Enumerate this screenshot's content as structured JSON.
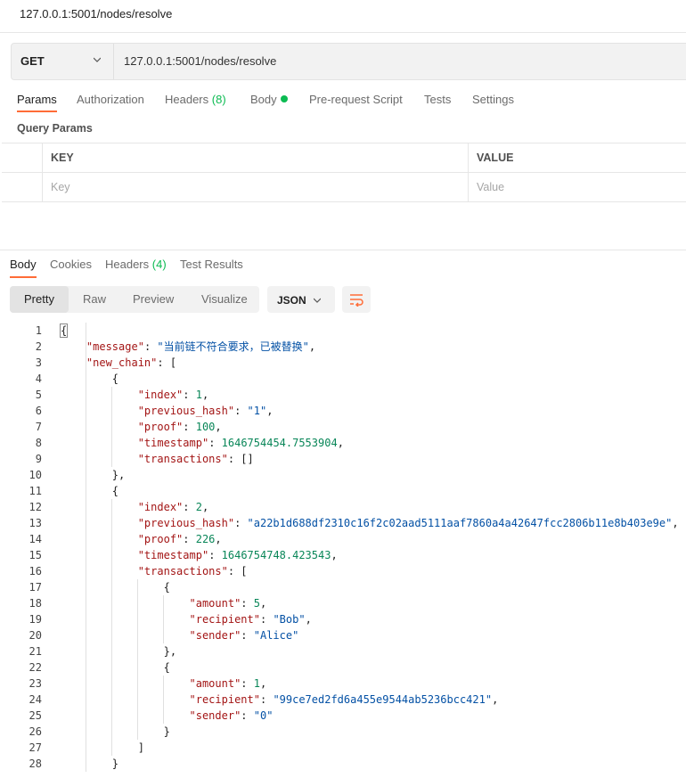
{
  "title": "127.0.0.1:5001/nodes/resolve",
  "request": {
    "method": "GET",
    "url": "127.0.0.1:5001/nodes/resolve"
  },
  "request_tabs": [
    {
      "label": "Params"
    },
    {
      "label": "Authorization"
    },
    {
      "label": "Headers",
      "count": "(8)"
    },
    {
      "label": "Body"
    },
    {
      "label": "Pre-request Script"
    },
    {
      "label": "Tests"
    },
    {
      "label": "Settings"
    }
  ],
  "query_params": {
    "label": "Query Params",
    "key_header": "KEY",
    "value_header": "VALUE",
    "key_placeholder": "Key",
    "value_placeholder": "Value"
  },
  "response_tabs": [
    {
      "label": "Body"
    },
    {
      "label": "Cookies"
    },
    {
      "label": "Headers",
      "count": "(4)"
    },
    {
      "label": "Test Results"
    }
  ],
  "view_modes": [
    "Pretty",
    "Raw",
    "Preview",
    "Visualize"
  ],
  "format": "JSON",
  "colors": {
    "accent": "#ff6c37",
    "key": "#a31515",
    "string": "#0451a5",
    "number": "#098658",
    "green": "#0cbb52"
  },
  "icons": {
    "method_dropdown": "chevron-down-icon",
    "format_dropdown": "chevron-down-icon",
    "wrap": "wrap-lines-icon"
  },
  "code_lines": [
    [
      [
        "p",
        "{"
      ]
    ],
    [
      [
        "p",
        "    "
      ],
      [
        "k",
        "\"message\""
      ],
      [
        "p",
        ": "
      ],
      [
        "s",
        "\"当前链不符合要求，已被替换\""
      ],
      [
        "p",
        ","
      ]
    ],
    [
      [
        "p",
        "    "
      ],
      [
        "k",
        "\"new_chain\""
      ],
      [
        "p",
        ": ["
      ]
    ],
    [
      [
        "p",
        "        {"
      ]
    ],
    [
      [
        "p",
        "            "
      ],
      [
        "k",
        "\"index\""
      ],
      [
        "p",
        ": "
      ],
      [
        "n",
        "1"
      ],
      [
        "p",
        ","
      ]
    ],
    [
      [
        "p",
        "            "
      ],
      [
        "k",
        "\"previous_hash\""
      ],
      [
        "p",
        ": "
      ],
      [
        "s",
        "\"1\""
      ],
      [
        "p",
        ","
      ]
    ],
    [
      [
        "p",
        "            "
      ],
      [
        "k",
        "\"proof\""
      ],
      [
        "p",
        ": "
      ],
      [
        "n",
        "100"
      ],
      [
        "p",
        ","
      ]
    ],
    [
      [
        "p",
        "            "
      ],
      [
        "k",
        "\"timestamp\""
      ],
      [
        "p",
        ": "
      ],
      [
        "n",
        "1646754454.7553904"
      ],
      [
        "p",
        ","
      ]
    ],
    [
      [
        "p",
        "            "
      ],
      [
        "k",
        "\"transactions\""
      ],
      [
        "p",
        ": []"
      ]
    ],
    [
      [
        "p",
        "        },"
      ]
    ],
    [
      [
        "p",
        "        {"
      ]
    ],
    [
      [
        "p",
        "            "
      ],
      [
        "k",
        "\"index\""
      ],
      [
        "p",
        ": "
      ],
      [
        "n",
        "2"
      ],
      [
        "p",
        ","
      ]
    ],
    [
      [
        "p",
        "            "
      ],
      [
        "k",
        "\"previous_hash\""
      ],
      [
        "p",
        ": "
      ],
      [
        "s",
        "\"a22b1d688df2310c16f2c02aad5111aaf7860a4a42647fcc2806b11e8b403e9e\""
      ],
      [
        "p",
        ","
      ]
    ],
    [
      [
        "p",
        "            "
      ],
      [
        "k",
        "\"proof\""
      ],
      [
        "p",
        ": "
      ],
      [
        "n",
        "226"
      ],
      [
        "p",
        ","
      ]
    ],
    [
      [
        "p",
        "            "
      ],
      [
        "k",
        "\"timestamp\""
      ],
      [
        "p",
        ": "
      ],
      [
        "n",
        "1646754748.423543"
      ],
      [
        "p",
        ","
      ]
    ],
    [
      [
        "p",
        "            "
      ],
      [
        "k",
        "\"transactions\""
      ],
      [
        "p",
        ": ["
      ]
    ],
    [
      [
        "p",
        "                {"
      ]
    ],
    [
      [
        "p",
        "                    "
      ],
      [
        "k",
        "\"amount\""
      ],
      [
        "p",
        ": "
      ],
      [
        "n",
        "5"
      ],
      [
        "p",
        ","
      ]
    ],
    [
      [
        "p",
        "                    "
      ],
      [
        "k",
        "\"recipient\""
      ],
      [
        "p",
        ": "
      ],
      [
        "s",
        "\"Bob\""
      ],
      [
        "p",
        ","
      ]
    ],
    [
      [
        "p",
        "                    "
      ],
      [
        "k",
        "\"sender\""
      ],
      [
        "p",
        ": "
      ],
      [
        "s",
        "\"Alice\""
      ]
    ],
    [
      [
        "p",
        "                },"
      ]
    ],
    [
      [
        "p",
        "                {"
      ]
    ],
    [
      [
        "p",
        "                    "
      ],
      [
        "k",
        "\"amount\""
      ],
      [
        "p",
        ": "
      ],
      [
        "n",
        "1"
      ],
      [
        "p",
        ","
      ]
    ],
    [
      [
        "p",
        "                    "
      ],
      [
        "k",
        "\"recipient\""
      ],
      [
        "p",
        ": "
      ],
      [
        "s",
        "\"99ce7ed2fd6a455e9544ab5236bcc421\""
      ],
      [
        "p",
        ","
      ]
    ],
    [
      [
        "p",
        "                    "
      ],
      [
        "k",
        "\"sender\""
      ],
      [
        "p",
        ": "
      ],
      [
        "s",
        "\"0\""
      ]
    ],
    [
      [
        "p",
        "                }"
      ]
    ],
    [
      [
        "p",
        "            ]"
      ]
    ],
    [
      [
        "p",
        "        }"
      ]
    ]
  ]
}
